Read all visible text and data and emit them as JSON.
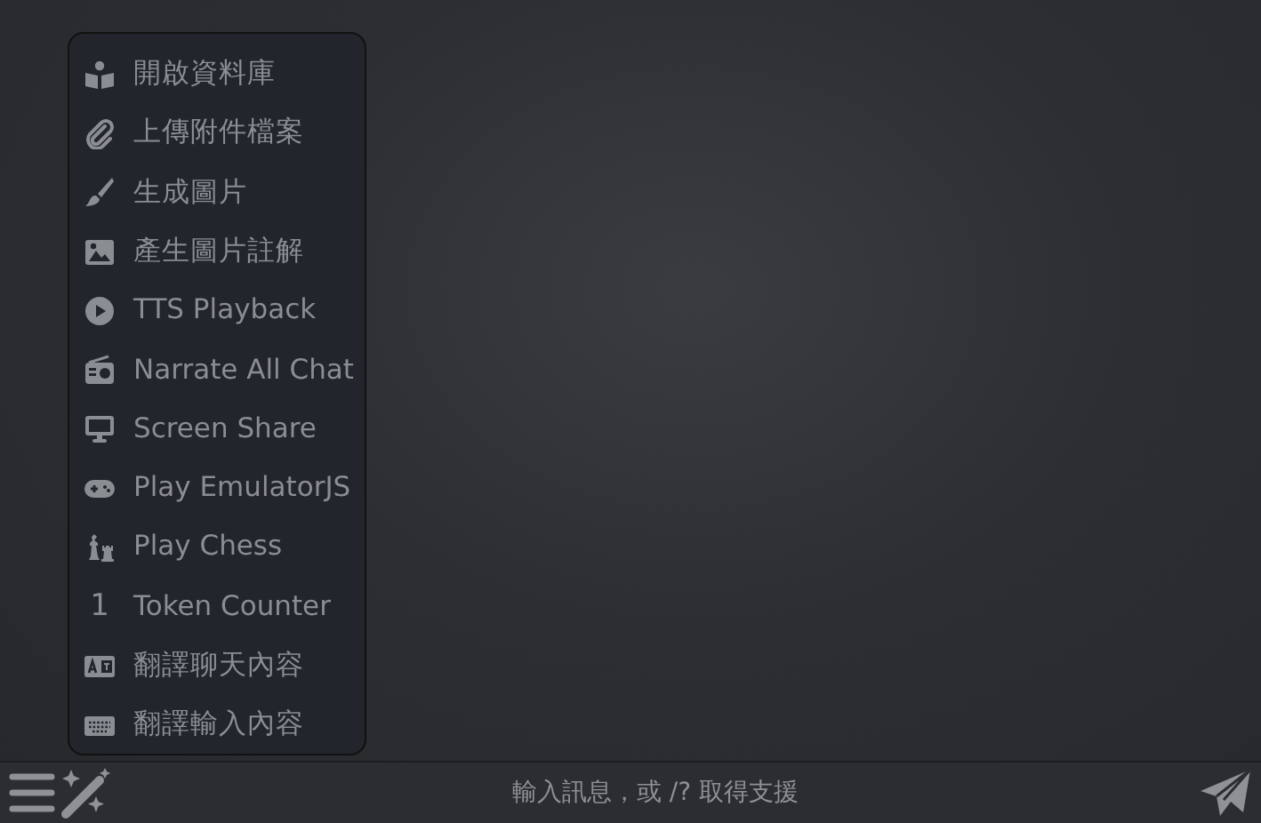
{
  "menu": {
    "items": [
      {
        "label": "開啟資料庫"
      },
      {
        "label": "上傳附件檔案"
      },
      {
        "label": "生成圖片"
      },
      {
        "label": "產生圖片註解"
      },
      {
        "label": "TTS Playback"
      },
      {
        "label": "Narrate All Chat"
      },
      {
        "label": "Screen Share"
      },
      {
        "label": "Play EmulatorJS"
      },
      {
        "label": "Play Chess"
      },
      {
        "label": "Token Counter",
        "glyph": "1"
      },
      {
        "label": "翻譯聊天內容"
      },
      {
        "label": "翻譯輸入內容"
      }
    ]
  },
  "input": {
    "placeholder": "輸入訊息，或 /? 取得支援"
  }
}
